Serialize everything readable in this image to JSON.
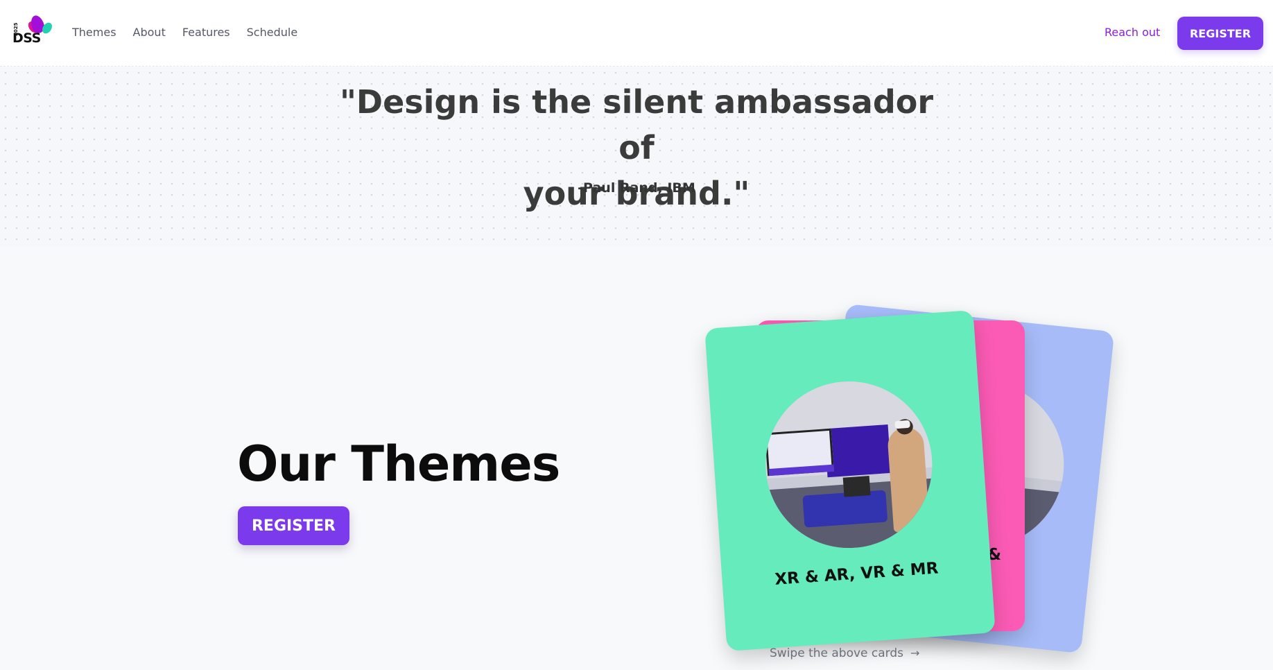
{
  "header": {
    "logo": {
      "year": "2025",
      "text": "DSS"
    },
    "nav": [
      {
        "label": "Themes"
      },
      {
        "label": "About"
      },
      {
        "label": "Features"
      },
      {
        "label": "Schedule"
      }
    ],
    "reach_out_label": "Reach out",
    "register_label": "REGISTER"
  },
  "quote": {
    "line1": "\"Design is the silent ambassador of",
    "line2": "your brand.\"",
    "author": "-Paul Rand, IBM"
  },
  "themes": {
    "title": "Our Themes",
    "register_label": "REGISTER",
    "cards": [
      {
        "caption": "",
        "color": "#a6bbf8"
      },
      {
        "caption": "&",
        "color": "#fb5bb5"
      },
      {
        "caption": "XR & AR, VR & MR",
        "color": "#66ebbc"
      }
    ],
    "swipe_hint": "Swipe the above cards",
    "swipe_arrow": "→"
  },
  "colors": {
    "accent": "#7c3aed",
    "reach_out": "#8a1fd1",
    "background": "#f8f9fb"
  }
}
